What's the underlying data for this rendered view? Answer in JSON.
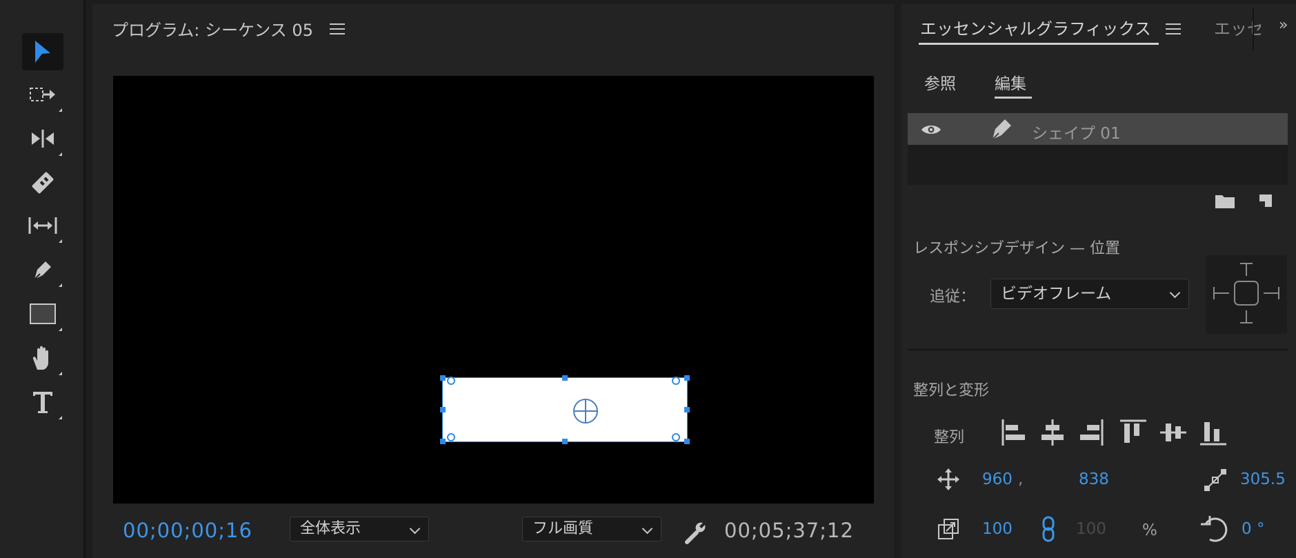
{
  "program": {
    "title": "プログラム: シーケンス 05",
    "timecode_current": "00;00;00;16",
    "zoom": "全体表示",
    "quality": "フル画質",
    "timecode_duration": "00;05;37;12"
  },
  "essential_graphics": {
    "tab_label": "エッセンシャルグラフィックス",
    "next_tab_label": "エッセンシャ",
    "more": "»",
    "subtabs": {
      "browse": "参照",
      "edit": "編集"
    },
    "layer_name": "シェイプ 01",
    "responsive_title": "レスポンシブデザイン — 位置",
    "follow_label": "追従：",
    "follow_value": "ビデオフレーム",
    "align_title": "整列と変形",
    "align_label": "整列",
    "position": {
      "x": "960",
      "sep": ",",
      "y": "838"
    },
    "anchor_value": "305.5",
    "scale": {
      "w": "100",
      "h": "100",
      "unit": "%"
    },
    "rotation": "0 °"
  },
  "colors": {
    "accent": "#3d95e8",
    "panel": "#232323",
    "background": "#1d1d1d"
  }
}
